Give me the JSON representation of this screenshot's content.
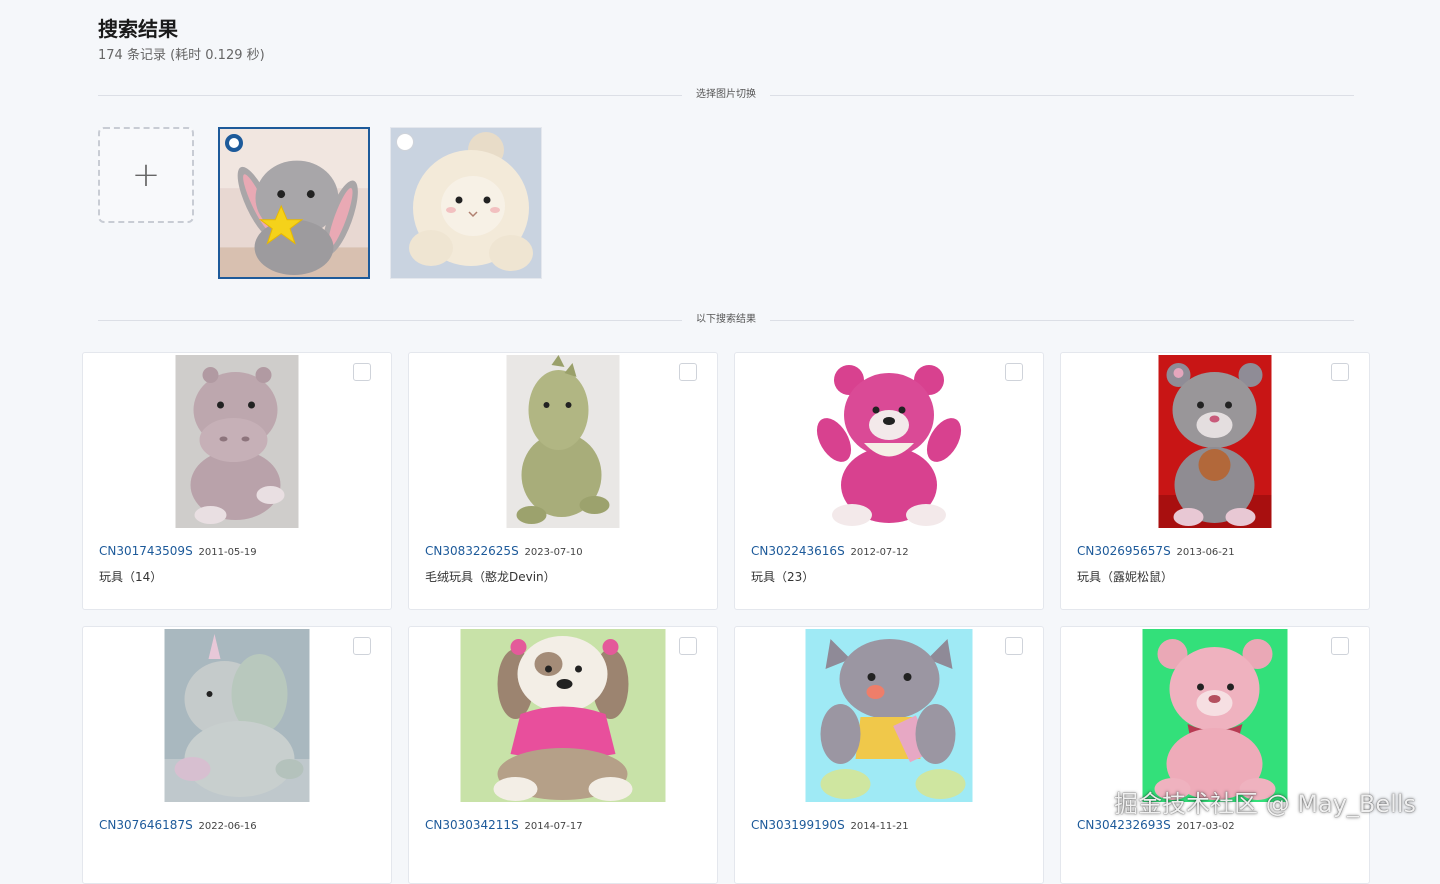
{
  "header": {
    "title": "搜索结果",
    "record_count": "174 条记录 (耗时 0.129 秒)"
  },
  "dividers": {
    "switch_label": "选择图片切换",
    "results_label": "以下搜索结果"
  },
  "upload": {
    "icon": "plus-icon",
    "glyph": "+"
  },
  "thumbnails": [
    {
      "subject": "grey bunny with yellow star",
      "selected": true
    },
    {
      "subject": "cream sheep plush",
      "selected": false
    }
  ],
  "results": [
    {
      "id": "CN301743509S",
      "date": "2011-05-19",
      "title": "玩具（14）"
    },
    {
      "id": "CN308322625S",
      "date": "2023-07-10",
      "title": "毛绒玩具（憨龙Devin）"
    },
    {
      "id": "CN302243616S",
      "date": "2012-07-12",
      "title": "玩具（23）"
    },
    {
      "id": "CN302695657S",
      "date": "2013-06-21",
      "title": "玩具（露妮松鼠）"
    },
    {
      "id": "CN307646187S",
      "date": "2022-06-16",
      "title": ""
    },
    {
      "id": "CN303034211S",
      "date": "2014-07-17",
      "title": ""
    },
    {
      "id": "CN303199190S",
      "date": "2014-11-21",
      "title": ""
    },
    {
      "id": "CN304232693S",
      "date": "2017-03-02",
      "title": ""
    }
  ],
  "colors": {
    "accent": "#1d5a9a",
    "background": "#f5f7fa"
  },
  "watermark": "掘金技术社区 @ May_Bells"
}
